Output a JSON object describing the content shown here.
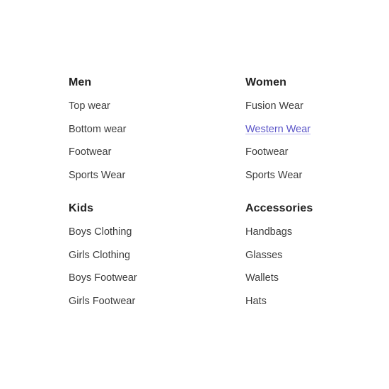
{
  "menu": {
    "groups": [
      {
        "title": "Men",
        "links": [
          "Top wear",
          "Bottom wear",
          "Footwear",
          "Sports Wear"
        ]
      },
      {
        "title": "Women",
        "links": [
          "Fusion Wear",
          "Western Wear",
          "Footwear",
          "Sports Wear"
        ],
        "hovered_link": "Western Wear"
      },
      {
        "title": "Kids",
        "links": [
          "Boys Clothing",
          "Girls Clothing",
          "Boys Footwear",
          "Girls Footwear"
        ]
      },
      {
        "title": "Accessories",
        "links": [
          "Handbags",
          "Glasses",
          "Wallets",
          "Hats"
        ]
      }
    ]
  },
  "colors": {
    "heading": "#222222",
    "link": "#3d3d3d",
    "link_hover": "#5b55c8",
    "background": "#ffffff"
  }
}
